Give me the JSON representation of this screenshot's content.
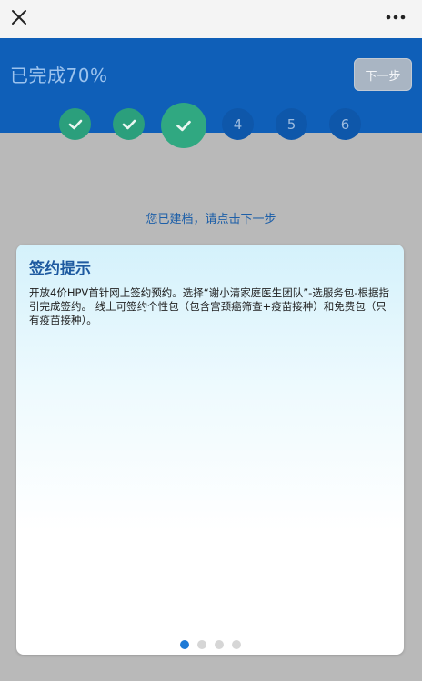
{
  "topbar": {
    "close_icon": "close-icon",
    "more_icon": "more-icon"
  },
  "header": {
    "progress_text": "已完成70%",
    "next_label": "下一步"
  },
  "steps": [
    {
      "state": "done",
      "icon": "check-icon"
    },
    {
      "state": "done",
      "icon": "check-icon"
    },
    {
      "state": "current",
      "icon": "check-icon"
    },
    {
      "state": "todo",
      "label": "4"
    },
    {
      "state": "todo",
      "label": "5"
    },
    {
      "state": "todo",
      "label": "6"
    }
  ],
  "status_message": "您已建档，请点击下一步",
  "card": {
    "title": "签约提示",
    "body": "开放4价HPV首针网上签约预约。选择“谢小清家庭医生团队”-选服务包-根据指引完成签约。 线上可签约个性包（包含宫颈癌筛查+疫苗接种）和免费包（只有疫苗接种）。"
  },
  "pager": {
    "total": 4,
    "active_index": 0
  },
  "colors": {
    "header_blue": "#0f5fb8",
    "done_green": "#2b9f7c",
    "active_dot": "#1e7ad6"
  }
}
